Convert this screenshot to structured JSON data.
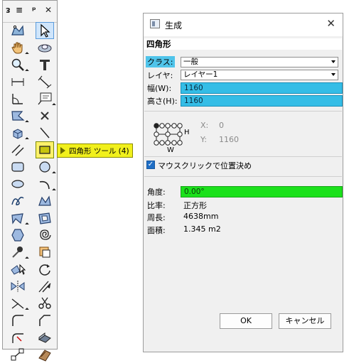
{
  "palette": {
    "toolbar": {
      "menu_label": "≡",
      "pin_label": "ᵖ",
      "close_label": "✕"
    },
    "tools": [
      {
        "name": "reshape-tool-icon"
      },
      {
        "name": "selection-tool-icon"
      },
      {
        "name": "pan-tool-icon"
      },
      {
        "name": "flyover-tool-icon"
      },
      {
        "name": "zoom-tool-icon"
      },
      {
        "name": "text-tool-icon"
      },
      {
        "name": "dimension-tool-icon"
      },
      {
        "name": "angled-dimension-tool-icon"
      },
      {
        "name": "angle-dimension-tool-icon"
      },
      {
        "name": "callout-tool-icon"
      },
      {
        "name": "clip-tool-icon"
      },
      {
        "name": "delete-tool-icon"
      },
      {
        "name": "push-pull-tool-icon"
      },
      {
        "name": "line-tool-icon"
      },
      {
        "name": "double-line-tool-icon"
      },
      {
        "name": "rectangle-tool-icon"
      },
      {
        "name": "rounded-rectangle-tool-icon"
      },
      {
        "name": "circle-tool-icon"
      },
      {
        "name": "oval-tool-icon"
      },
      {
        "name": "arc-tool-icon"
      },
      {
        "name": "freehand-tool-icon"
      },
      {
        "name": "polyline-tool-icon"
      },
      {
        "name": "polygon-tool-icon"
      },
      {
        "name": "double-polygon-tool-icon"
      },
      {
        "name": "regular-polygon-tool-icon"
      },
      {
        "name": "spiral-tool-icon"
      },
      {
        "name": "eyedropper-tool-icon"
      },
      {
        "name": "attribute-mapping-tool-icon"
      },
      {
        "name": "select-similar-tool-icon"
      },
      {
        "name": "rotate-tool-icon"
      },
      {
        "name": "mirror-tool-icon"
      },
      {
        "name": "offset-tool-icon"
      },
      {
        "name": "connect-tool-icon"
      },
      {
        "name": "split-tool-icon"
      },
      {
        "name": "fillet-tool-icon"
      },
      {
        "name": "chamfer-tool-icon"
      },
      {
        "name": "trim-tool-icon"
      },
      {
        "name": "bend-tool-icon"
      },
      {
        "name": "move-by-points-tool-icon"
      },
      {
        "name": "wall-tool-icon"
      }
    ]
  },
  "tooltip": {
    "label": "四角形 ツール (4)"
  },
  "dialog": {
    "title": "生成",
    "close_label": "✕",
    "heading": "四角形",
    "class_label": "クラス:",
    "class_value": "一般",
    "layer_label": "レイヤ:",
    "layer_value": "レイヤー1",
    "width_label": "幅(W):",
    "width_value": "1160",
    "height_label": "高さ(H):",
    "height_value": "1160",
    "x_label": "X:",
    "x_value": "0",
    "y_label": "Y:",
    "y_value": "1160",
    "diagram_h_label": "H",
    "diagram_w_label": "W",
    "mouse_click_label": "マウスクリックで位置決め",
    "angle_label": "角度:",
    "angle_value": "0.00°",
    "ratio_label": "比率:",
    "ratio_value": "正方形",
    "perimeter_label": "周長:",
    "perimeter_value": "4638mm",
    "area_label": "面積:",
    "area_value": "1.345 m2",
    "ok_label": "OK",
    "cancel_label": "キャンセル"
  },
  "colors": {
    "highlight_cyan": "#35bde6",
    "highlight_green": "#1be11b",
    "tooltip_yellow": "#f1f01c",
    "checkbox_blue": "#1f6ec5"
  }
}
